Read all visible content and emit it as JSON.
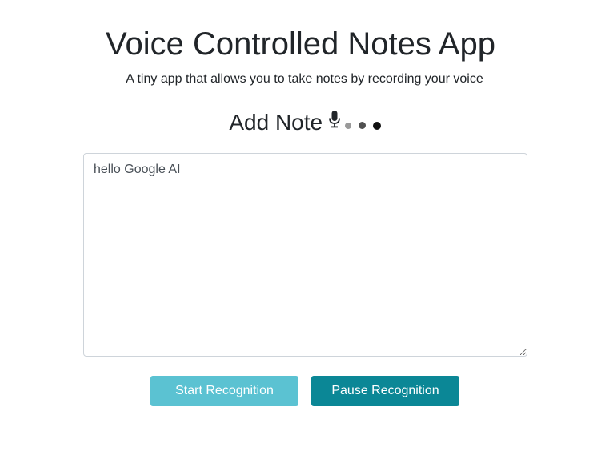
{
  "header": {
    "title": "Voice Controlled Notes App",
    "subtitle": "A tiny app that allows you to take notes by recording your voice"
  },
  "note_section": {
    "heading": "Add Note",
    "mic_icon": "microphone-icon",
    "indicator_icon": "recording-dots-icon",
    "note_text": "hello Google AI"
  },
  "actions": {
    "start_label": "Start Recognition",
    "pause_label": "Pause Recognition"
  },
  "colors": {
    "start_button": "#5bc2d2",
    "pause_button": "#0b8796"
  }
}
